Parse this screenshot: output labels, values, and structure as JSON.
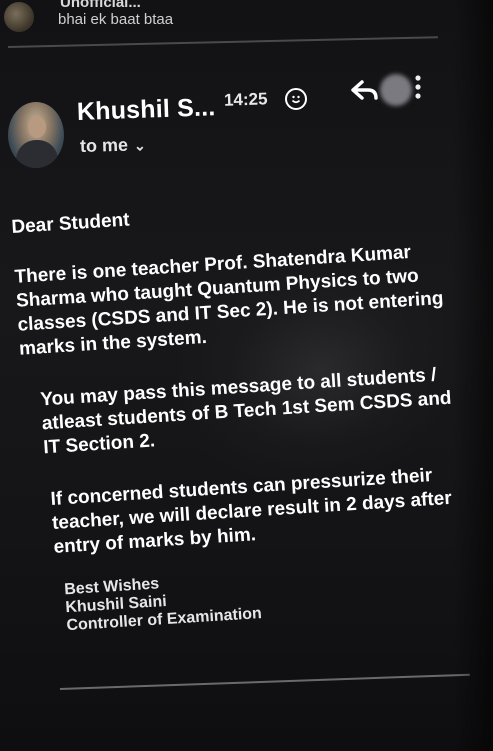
{
  "previous_message": {
    "sender": "Unofficial...",
    "snippet": "bhai ek baat btaa"
  },
  "header": {
    "sender_name": "Khushil S...",
    "time": "14:25",
    "recipient": "to me"
  },
  "icons": {
    "emoji": "emoji-reaction-icon",
    "reply": "reply-arrow-icon",
    "more": "more-vertical-icon",
    "chevron": "chevron-down-icon"
  },
  "email": {
    "greeting": "Dear Student",
    "paragraph_1": "There is one teacher Prof. Shatendra Kumar Sharma who taught Quantum Physics to two classes (CSDS and IT Sec 2). He is not entering marks in the system.",
    "paragraph_2": "You may pass this message to all students / atleast students of B Tech 1st Sem CSDS and IT Section 2.",
    "paragraph_3": "If concerned students can pressurize their teacher, we will declare result in 2 days after entry of marks by him.",
    "signature": {
      "closing": "Best Wishes",
      "name": "Khushil Saini",
      "title": "Controller of Examination"
    }
  }
}
